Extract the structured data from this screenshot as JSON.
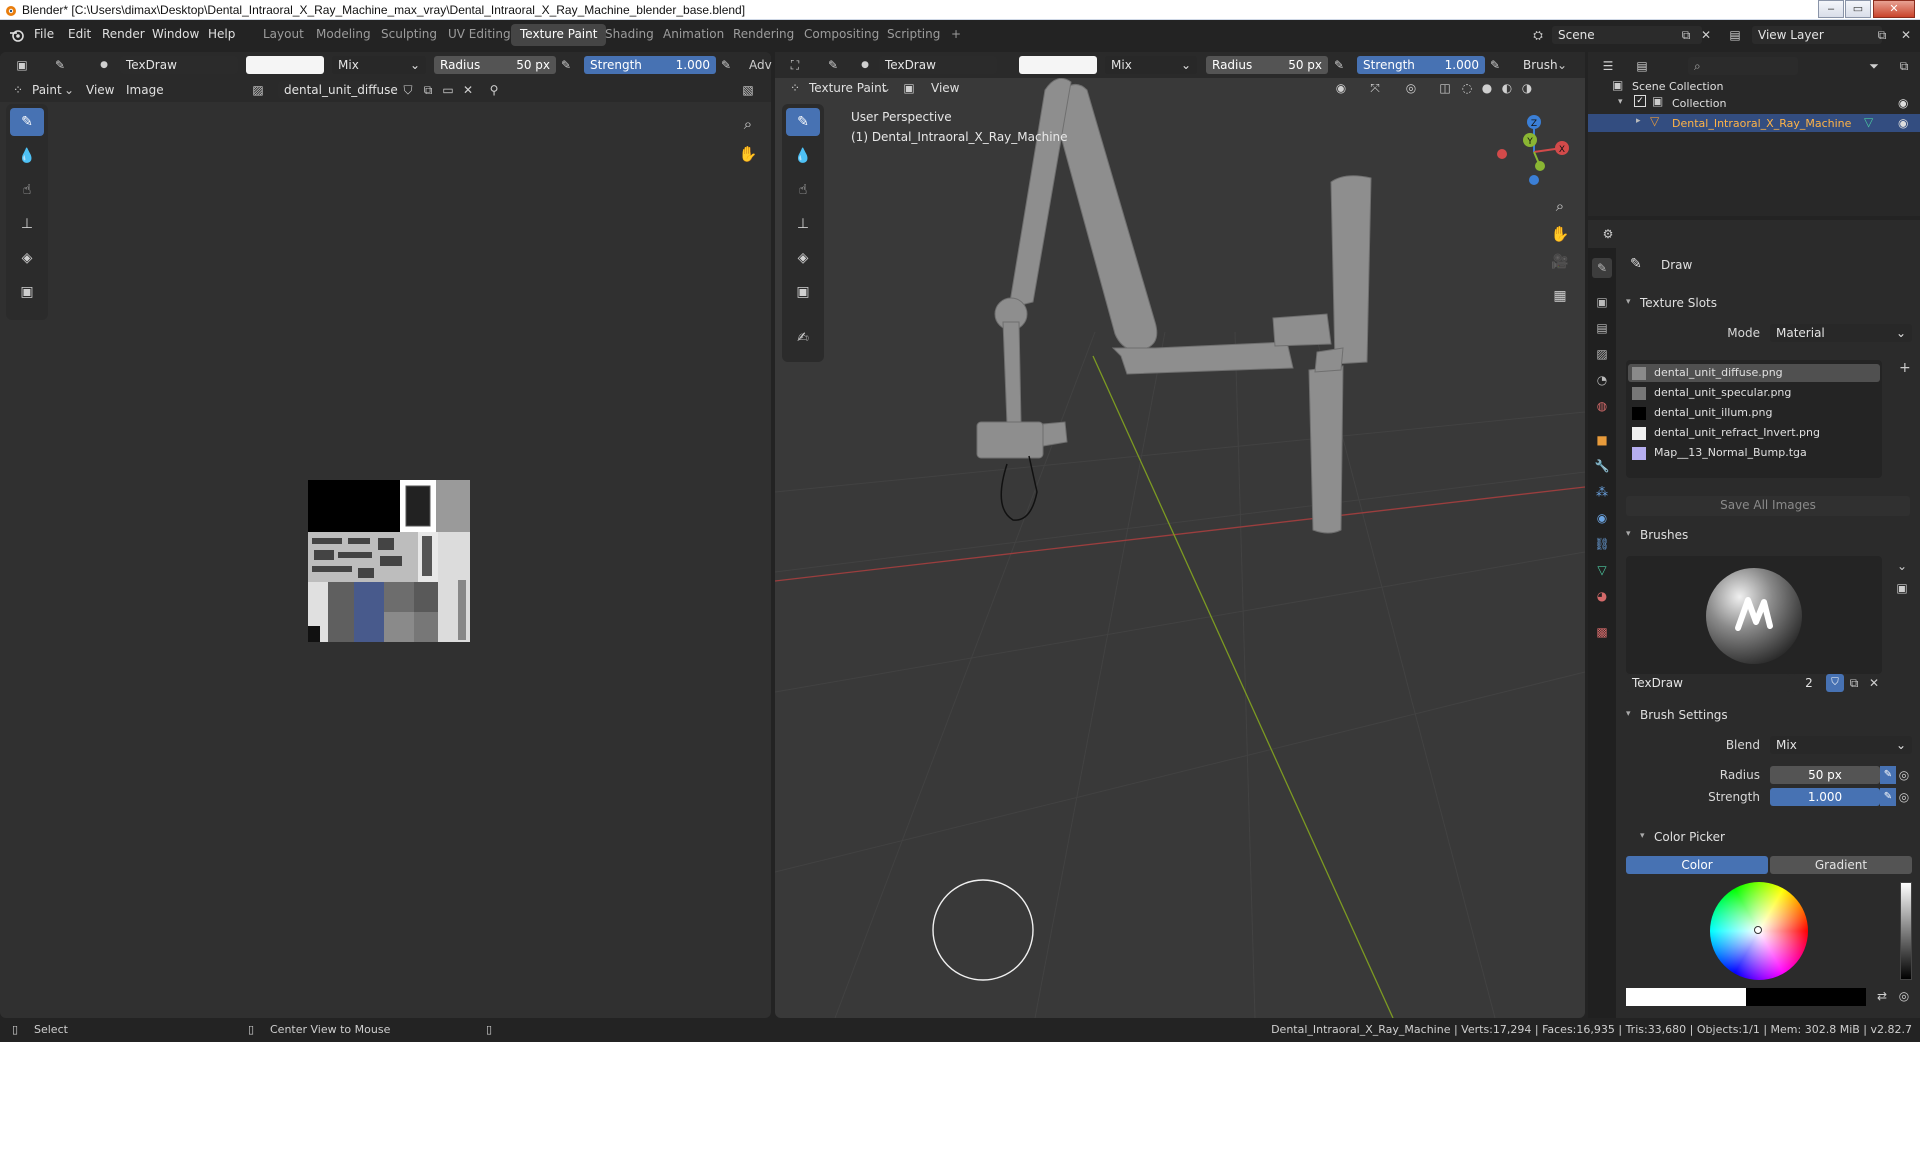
{
  "window": {
    "title": "Blender* [C:\\Users\\dimax\\Desktop\\Dental_Intraoral_X_Ray_Machine_max_vray\\Dental_Intraoral_X_Ray_Machine_blender_base.blend]",
    "controls": [
      "–",
      "▭",
      "✕"
    ]
  },
  "menu": [
    "File",
    "Edit",
    "Render",
    "Window",
    "Help"
  ],
  "workspaces": [
    "Layout",
    "Modeling",
    "Sculpting",
    "UV Editing",
    "Texture Paint",
    "Shading",
    "Animation",
    "Rendering",
    "Compositing",
    "Scripting"
  ],
  "workspace_add": "+",
  "scene": {
    "label": "Scene",
    "view_layer": "View Layer"
  },
  "image_editor": {
    "brush_name": "TexDraw",
    "blend": "Mix",
    "radius_label": "Radius",
    "radius_value": "50 px",
    "strength_label": "Strength",
    "strength_value": "1.000",
    "adv": "Adv",
    "mode": "Paint",
    "menu_view": "View",
    "menu_image": "Image",
    "image_name": "dental_unit_diffuse.p..."
  },
  "view3d": {
    "brush_name": "TexDraw",
    "blend": "Mix",
    "radius_label": "Radius",
    "radius_value": "50 px",
    "strength_label": "Strength",
    "strength_value": "1.000",
    "brush_menu": "Brush",
    "mode": "Texture Paint",
    "menu_view": "View",
    "overlay_title": "User Perspective",
    "overlay_object": "(1) Dental_Intraoral_X_Ray_Machine",
    "gizmo": {
      "z": "Z",
      "y": "Y",
      "x": "X"
    }
  },
  "outliner": {
    "scene_collection": "Scene Collection",
    "collection": "Collection",
    "object": "Dental_Intraoral_X_Ray_Machine"
  },
  "properties": {
    "tool": "Draw",
    "texture_slots": {
      "title": "Texture Slots",
      "mode_label": "Mode",
      "mode_value": "Material",
      "slots": [
        "dental_unit_diffuse.png",
        "dental_unit_specular.png",
        "dental_unit_illum.png",
        "dental_unit_refract_Invert.png",
        "Map__13_Normal_Bump.tga"
      ],
      "save_all": "Save All Images"
    },
    "brushes": {
      "title": "Brushes",
      "name": "TexDraw",
      "users": "2"
    },
    "brush_settings": {
      "title": "Brush Settings",
      "blend_label": "Blend",
      "blend_value": "Mix",
      "radius_label": "Radius",
      "radius_value": "50 px",
      "strength_label": "Strength",
      "strength_value": "1.000"
    },
    "color_picker": {
      "title": "Color Picker",
      "tab_color": "Color",
      "tab_gradient": "Gradient"
    }
  },
  "status": {
    "select": "Select",
    "center_view": "Center View to Mouse",
    "stats": "Dental_Intraoral_X_Ray_Machine | Verts:17,294 | Faces:16,935 | Tris:33,680 | Objects:1/1 | Mem: 302.8 MiB | v2.82.7"
  },
  "colors": {
    "accent": "#4772b3",
    "background": "#232323",
    "viewport": "#393939",
    "x_axis": "#d24a4a",
    "y_axis": "#8ab633",
    "z_axis": "#3b7fd6"
  }
}
